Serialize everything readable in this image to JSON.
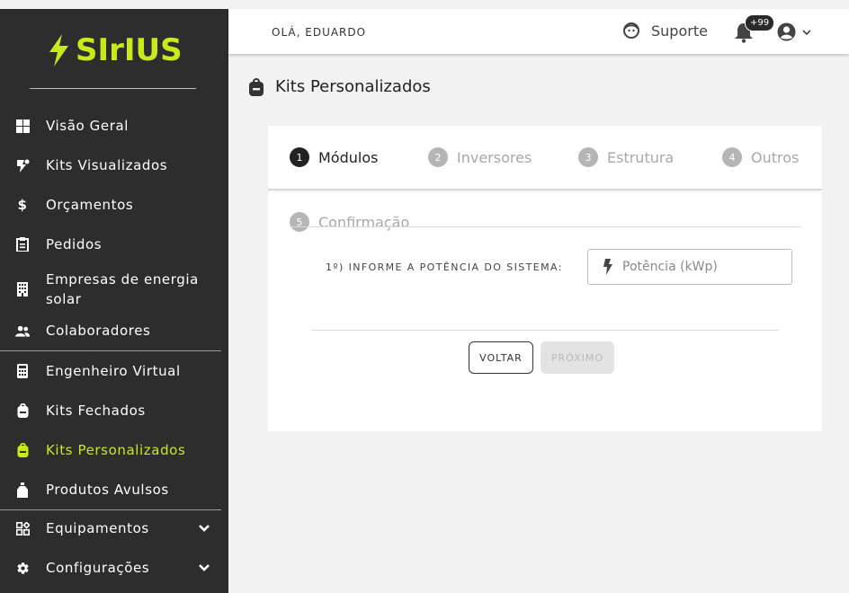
{
  "brand": {
    "name": "SIrIUS",
    "accent": "#c8ea1b"
  },
  "sidebar": {
    "items": [
      {
        "label": "Visão Geral",
        "icon": "dashboard-icon"
      },
      {
        "label": "Kits Visualizados",
        "icon": "kits-viewed-icon"
      },
      {
        "label": "Orçamentos",
        "icon": "dollar-icon"
      },
      {
        "label": "Pedidos",
        "icon": "clipboard-icon"
      },
      {
        "label": "Empresas de energia solar",
        "icon": "building-icon"
      },
      {
        "label": "Colaboradores",
        "icon": "users-icon"
      },
      {
        "label": "Engenheiro Virtual",
        "icon": "calculator-icon"
      },
      {
        "label": "Kits Fechados",
        "icon": "backpack-icon"
      },
      {
        "label": "Kits Personalizados",
        "icon": "backpack-icon",
        "active": true
      },
      {
        "label": "Produtos Avulsos",
        "icon": "bottle-icon"
      },
      {
        "label": "Equipamentos",
        "icon": "widgets-icon",
        "expandable": true
      },
      {
        "label": "Configurações",
        "icon": "gear-icon",
        "expandable": true
      }
    ]
  },
  "header": {
    "greeting": "OLÁ, EDUARDO",
    "support_label": "Suporte",
    "notifications_badge": "+99"
  },
  "page": {
    "title": "Kits Personalizados"
  },
  "wizard": {
    "steps": [
      {
        "number": "1",
        "label": "Módulos",
        "current": true
      },
      {
        "number": "2",
        "label": "Inversores"
      },
      {
        "number": "3",
        "label": "Estrutura"
      },
      {
        "number": "4",
        "label": "Outros"
      },
      {
        "number": "5",
        "label": "Confirmação"
      }
    ],
    "form": {
      "label": "1º) INFORME A POTÊNCIA DO SISTEMA:",
      "power_placeholder": "Potência (kWp)",
      "power_value": ""
    },
    "back_label": "VOLTAR",
    "next_label": "PRÓXIMO"
  }
}
